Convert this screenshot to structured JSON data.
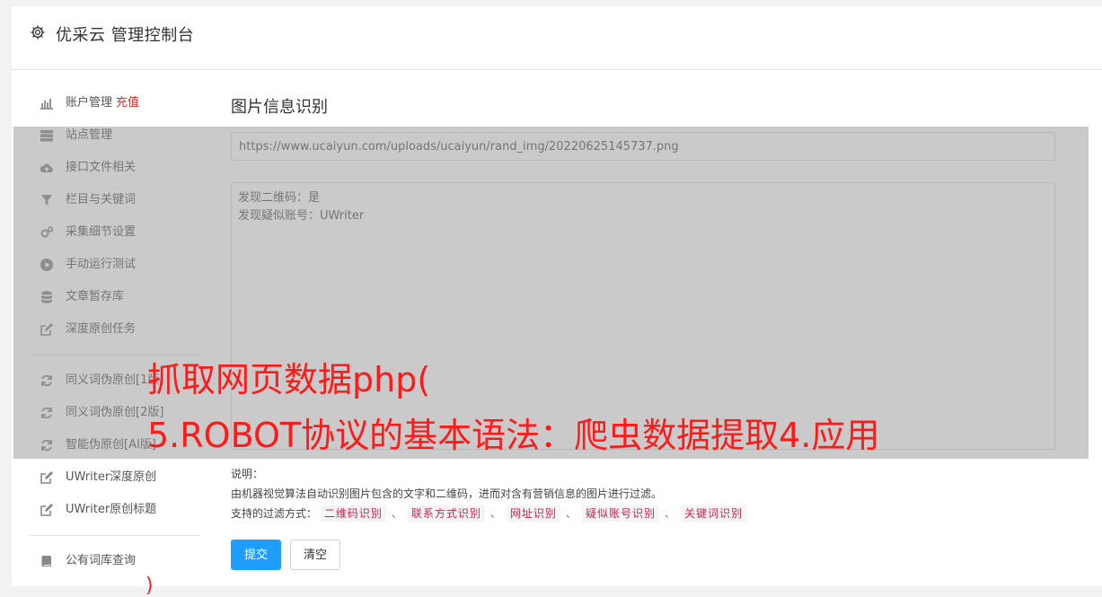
{
  "header": {
    "title": "优采云 管理控制台",
    "icon": "gear-icon"
  },
  "sidebar": {
    "group1": [
      {
        "label": "账户管理",
        "accent": "充值",
        "icon": "bar-chart-icon"
      },
      {
        "label": "站点管理",
        "icon": "server-icon"
      },
      {
        "label": "接口文件相关",
        "icon": "cloud-upload-icon"
      },
      {
        "label": "栏目与关键词",
        "icon": "filter-icon"
      },
      {
        "label": "采集细节设置",
        "icon": "gears-icon"
      },
      {
        "label": "手动运行测试",
        "icon": "play-circle-icon"
      },
      {
        "label": "文章暂存库",
        "icon": "database-icon"
      },
      {
        "label": "深度原创任务",
        "icon": "edit-icon"
      }
    ],
    "group2": [
      {
        "label": "同义词伪原创[1版]",
        "icon": "refresh-icon"
      },
      {
        "label": "同义词伪原创[2版]",
        "icon": "refresh-icon"
      },
      {
        "label": "智能伪原创[AI版]",
        "icon": "refresh-icon"
      },
      {
        "label": "UWriter深度原创",
        "icon": "edit-icon"
      },
      {
        "label": "UWriter原创标题",
        "icon": "edit-icon"
      }
    ],
    "group3": [
      {
        "label": "公有词库查询",
        "icon": "book-icon"
      }
    ]
  },
  "main": {
    "section_title": "图片信息识别",
    "url_value": "https://www.ucaiyun.com/uploads/ucaiyun/rand_img/20220625145737.png",
    "result_lines": [
      "发现二维码：是",
      "发现疑似账号：UWriter"
    ],
    "notes": {
      "heading": "说明：",
      "description": "由机器视觉算法自动识别图片包含的文字和二维码，进而对含有营销信息的图片进行过滤。",
      "filters_label": "支持的过滤方式：",
      "filters": [
        "二维码识别",
        "联系方式识别",
        "网址识别",
        "疑似账号识别",
        "关键词识别"
      ],
      "separator": "、"
    },
    "buttons": {
      "submit": "提交",
      "clear": "清空"
    }
  },
  "overlay": {
    "line1": "抓取网页数据php(",
    "line2": "5.ROBOT协议的基本语法：爬虫数据提取4.应用",
    "trailing_mark": ")"
  },
  "colors": {
    "accent_red": "#e0292a",
    "primary_blue": "#1e9fff",
    "tag_text": "#c7254e",
    "overlay_text": "#ff1a1a"
  }
}
